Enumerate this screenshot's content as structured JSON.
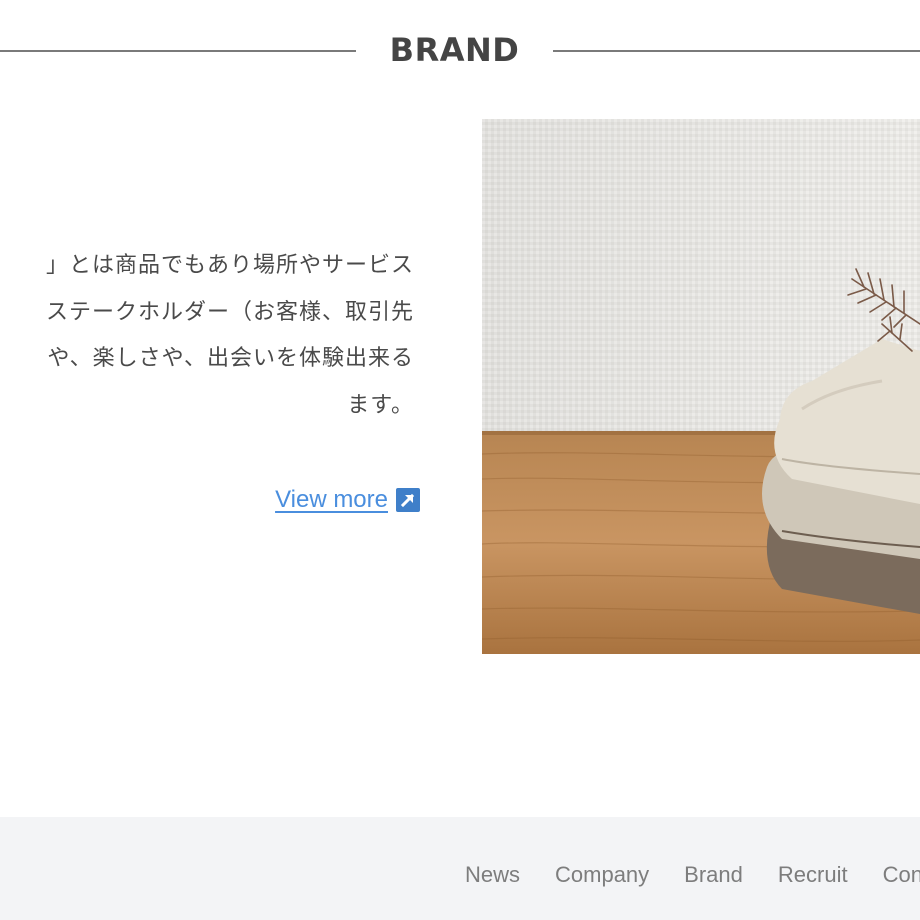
{
  "section": {
    "title": "BRAND"
  },
  "body_copy": [
    "」とは商品でもあり場所やサービス",
    "ステークホルダー（お客様、取引先",
    "や、楽しさや、出会いを体験出来る",
    "ます。"
  ],
  "view_more": {
    "label": "View more"
  },
  "photo": {
    "subject": "stacked knit sweaters with dried plant on wooden table"
  },
  "footer": {
    "nav": [
      "News",
      "Company",
      "Brand",
      "Recruit",
      "Contact"
    ]
  },
  "colors": {
    "link": "#4a8ede",
    "link_icon_bg": "#3f7fc9",
    "footer_bg": "#f3f4f6",
    "rule": "#7a7a7a"
  }
}
